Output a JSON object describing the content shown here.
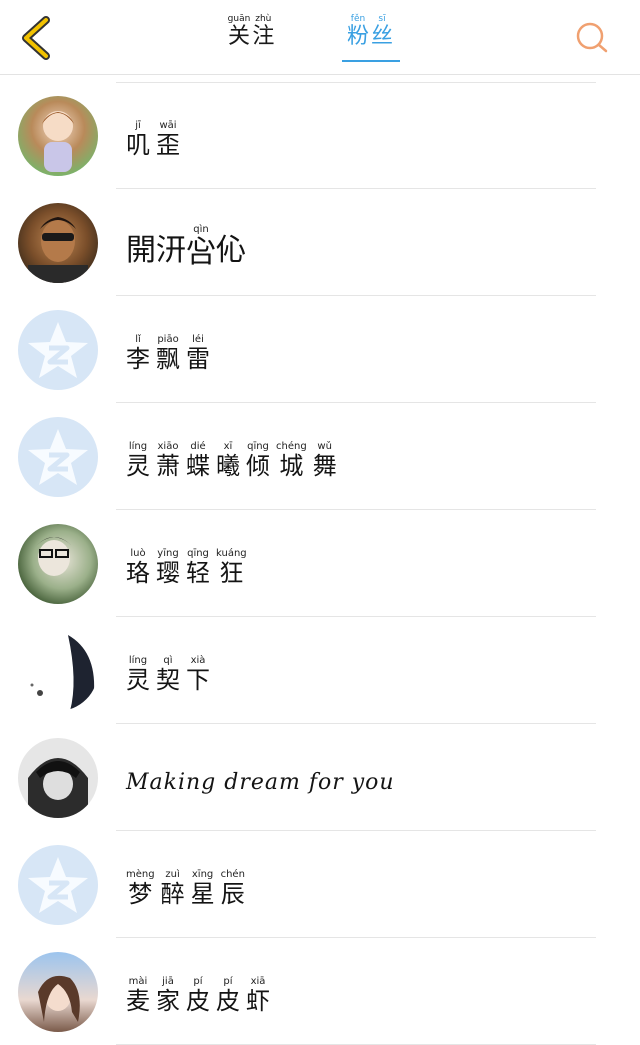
{
  "header": {
    "tabs": [
      {
        "id": "follow",
        "chars": [
          {
            "c": "关",
            "py": "guān"
          },
          {
            "c": "注",
            "py": "zhù"
          }
        ],
        "active": false
      },
      {
        "id": "fans",
        "chars": [
          {
            "c": "粉",
            "py": "fěn"
          },
          {
            "c": "丝",
            "py": "sī"
          }
        ],
        "active": true
      }
    ],
    "icons": {
      "back": "chevron-left-icon",
      "search": "search-icon"
    },
    "colors": {
      "accent": "#3aa0e2",
      "back": "#f2c200",
      "search": "#f0a070"
    }
  },
  "fans": [
    {
      "name": "叽歪",
      "type": "ruby",
      "chars": [
        {
          "c": "叽",
          "py": "jī"
        },
        {
          "c": "歪",
          "py": "wāi"
        }
      ],
      "avatar": "anime-girl-avatar"
    },
    {
      "name": "開汧吢伈",
      "type": "plain",
      "chars": [
        {
          "c": "開",
          "py": ""
        },
        {
          "c": "汧",
          "py": ""
        },
        {
          "c": "吢",
          "py": "qìn"
        },
        {
          "c": "伈",
          "py": ""
        }
      ],
      "avatar": "man-sunglasses-avatar"
    },
    {
      "name": "李飘雷",
      "type": "ruby",
      "chars": [
        {
          "c": "李",
          "py": "lǐ"
        },
        {
          "c": "飘",
          "py": "piāo"
        },
        {
          "c": "雷",
          "py": "léi"
        }
      ],
      "avatar": "default-star-avatar"
    },
    {
      "name": "灵萧蝶曦倾城舞",
      "type": "ruby",
      "chars": [
        {
          "c": "灵",
          "py": "líng"
        },
        {
          "c": "萧",
          "py": "xiāo"
        },
        {
          "c": "蝶",
          "py": "dié"
        },
        {
          "c": "曦",
          "py": "xī"
        },
        {
          "c": "倾",
          "py": "qīng"
        },
        {
          "c": "城",
          "py": "chéng"
        },
        {
          "c": "舞",
          "py": "wǔ"
        }
      ],
      "avatar": "default-star-avatar"
    },
    {
      "name": "珞璎轻狂",
      "type": "ruby",
      "chars": [
        {
          "c": "珞",
          "py": "luò"
        },
        {
          "c": "璎",
          "py": "yīng"
        },
        {
          "c": "轻",
          "py": "qīng"
        },
        {
          "c": "狂",
          "py": "kuáng"
        }
      ],
      "avatar": "boy-glasses-avatar"
    },
    {
      "name": "灵契下",
      "type": "ruby",
      "chars": [
        {
          "c": "灵",
          "py": "líng"
        },
        {
          "c": "契",
          "py": "qì"
        },
        {
          "c": "下",
          "py": "xià"
        }
      ],
      "avatar": "sketch-avatar"
    },
    {
      "name": "Making dream for you",
      "type": "latin",
      "chars": [],
      "avatar": "anime-boy-avatar"
    },
    {
      "name": "梦醉星辰",
      "type": "ruby",
      "chars": [
        {
          "c": "梦",
          "py": "mèng"
        },
        {
          "c": "醉",
          "py": "zuì"
        },
        {
          "c": "星",
          "py": "xīng"
        },
        {
          "c": "辰",
          "py": "chén"
        }
      ],
      "avatar": "default-star-avatar"
    },
    {
      "name": "麦家皮皮虾",
      "type": "ruby",
      "chars": [
        {
          "c": "麦",
          "py": "mài"
        },
        {
          "c": "家",
          "py": "jiā"
        },
        {
          "c": "皮",
          "py": "pí"
        },
        {
          "c": "皮",
          "py": "pí"
        },
        {
          "c": "虾",
          "py": "xiā"
        }
      ],
      "avatar": "anime-girl-sky-avatar"
    }
  ]
}
